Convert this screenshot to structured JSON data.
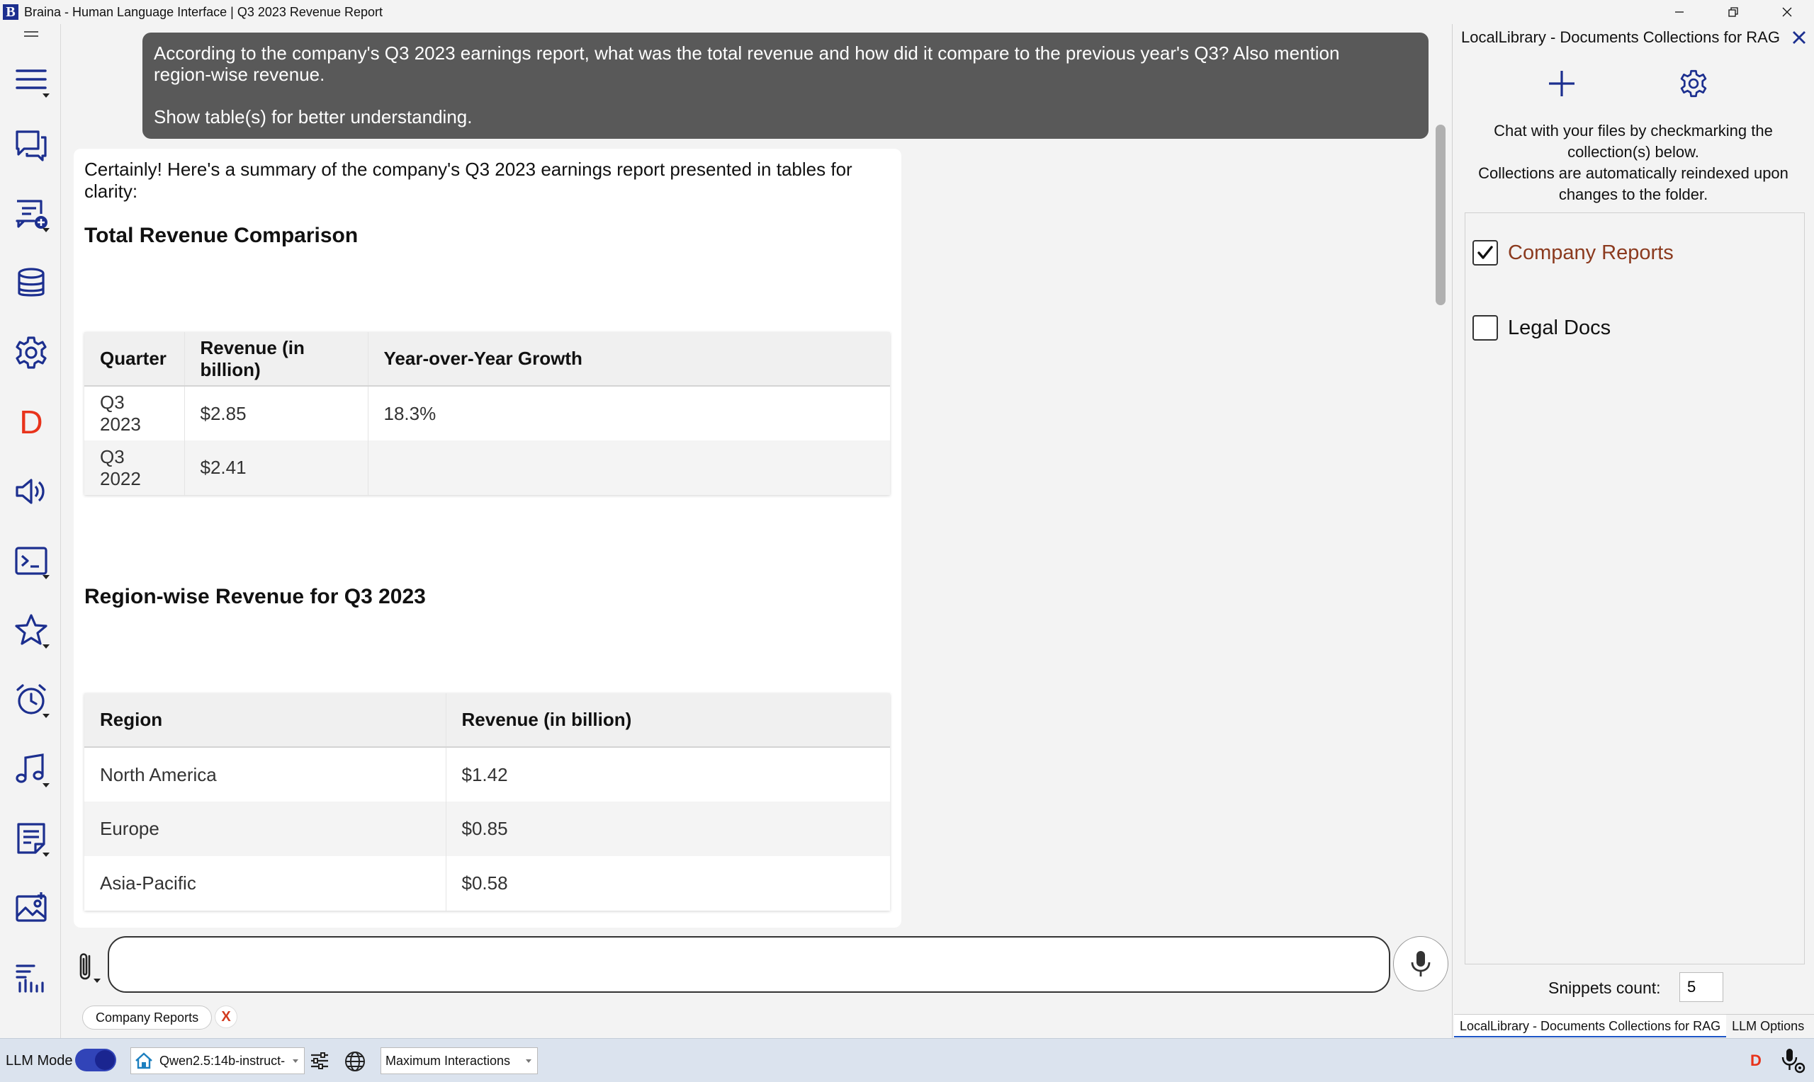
{
  "window": {
    "title": "Braina - Human Language Interface | Q3 2023 Revenue Report",
    "logo_letter": "B"
  },
  "sidebar": {
    "items": [
      {
        "name": "menu",
        "icon": "hamburger-menu-icon"
      },
      {
        "name": "chat",
        "icon": "chat-bubbles-icon"
      },
      {
        "name": "new-chat",
        "icon": "new-chat-icon"
      },
      {
        "name": "database",
        "icon": "database-icon"
      },
      {
        "name": "settings",
        "icon": "gear-icon"
      },
      {
        "name": "dictation",
        "icon": "d-letter-icon",
        "letter": "D",
        "color": "#e8331b"
      },
      {
        "name": "speaker",
        "icon": "speaker-icon"
      },
      {
        "name": "terminal",
        "icon": "terminal-icon"
      },
      {
        "name": "favorites",
        "icon": "star-icon"
      },
      {
        "name": "alarm",
        "icon": "alarm-clock-icon"
      },
      {
        "name": "music",
        "icon": "music-note-icon"
      },
      {
        "name": "notes",
        "icon": "notes-icon"
      },
      {
        "name": "image",
        "icon": "image-icon"
      },
      {
        "name": "voice",
        "icon": "voice-bars-icon"
      }
    ]
  },
  "chat": {
    "user_message_1": "According to the company's Q3 2023 earnings report, what was the total revenue and how did it compare to the previous year's Q3? Also mention region-wise revenue.",
    "user_message_2": "Show table(s) for better understanding.",
    "reply": {
      "intro": "Certainly! Here's a summary of the company's Q3 2023 earnings report presented in tables for clarity:",
      "heading_1": "Total Revenue Comparison",
      "table_1": {
        "headers": [
          "Quarter",
          "Revenue (in billion)",
          "Year-over-Year Growth"
        ],
        "rows": [
          [
            "Q3 2023",
            "$2.85",
            "18.3%"
          ],
          [
            "Q3 2022",
            "$2.41",
            ""
          ]
        ]
      },
      "heading_2": "Region-wise Revenue for Q3 2023",
      "table_2": {
        "headers": [
          "Region",
          "Revenue (in billion)"
        ],
        "rows": [
          [
            "North America",
            "$1.42"
          ],
          [
            "Europe",
            "$0.85"
          ],
          [
            "Asia-Pacific",
            "$0.58"
          ]
        ]
      }
    },
    "input": {
      "value": "",
      "placeholder": ""
    },
    "active_collection_chip": "Company Reports",
    "chip_remove": "X"
  },
  "right_panel": {
    "title": "LocalLibrary - Documents Collections for RAG",
    "description_1": "Chat with your files by checkmarking the collection(s) below.",
    "description_2": "Collections are automatically reindexed upon changes to the folder.",
    "collections": [
      {
        "label": "Company Reports",
        "checked": true,
        "color": "#8b3a1e"
      },
      {
        "label": "Legal Docs",
        "checked": false,
        "color": "#111111"
      }
    ],
    "snippets_label": "Snippets count:",
    "snippets_value": "5",
    "tabs": [
      {
        "label": "LocalLibrary - Documents Collections for RAG",
        "active": true
      },
      {
        "label": "LLM Options",
        "active": false
      }
    ]
  },
  "status_bar": {
    "llm_mode_label": "LLM Mode",
    "llm_mode_on": true,
    "model": "Qwen2.5:14b-instruct-",
    "interaction_mode": "Maximum Interactions",
    "badge": "D"
  },
  "colors": {
    "accent_blue": "#1c2f8f",
    "brand_red": "#e8331b",
    "user_bubble": "#595959",
    "status_bar": "#dbe3ee"
  }
}
